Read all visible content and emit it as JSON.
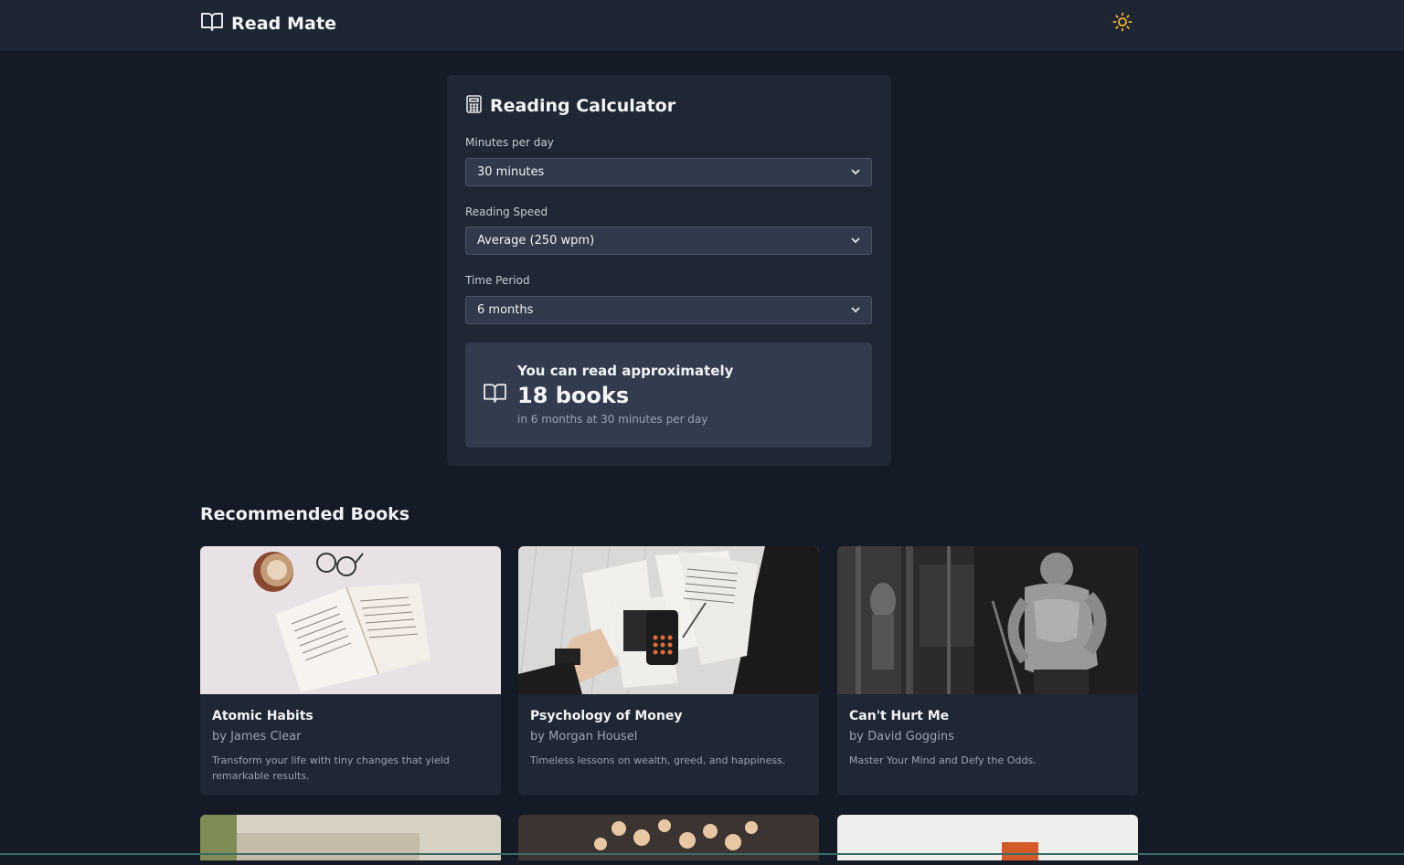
{
  "app": {
    "name": "Read Mate",
    "theme_toggle_icon": "sun-icon",
    "accent_color": "#f5b82e"
  },
  "calculator": {
    "title": "Reading Calculator",
    "icon": "calculator-icon",
    "fields": [
      {
        "label": "Minutes per day",
        "value": "30 minutes"
      },
      {
        "label": "Reading Speed",
        "value": "Average (250 wpm)"
      },
      {
        "label": "Time Period",
        "value": "6 months"
      }
    ],
    "result": {
      "icon": "book-open-icon",
      "lead": "You can read approximately",
      "value": "18 books",
      "detail": "in 6 months at 30 minutes per day"
    }
  },
  "recommended": {
    "title": "Recommended Books",
    "books": [
      {
        "title": "Atomic Habits",
        "author": "by James Clear",
        "description": "Transform your life with tiny changes that yield remarkable results."
      },
      {
        "title": "Psychology of Money",
        "author": "by Morgan Housel",
        "description": "Timeless lessons on wealth, greed, and happiness."
      },
      {
        "title": "Can't Hurt Me",
        "author": "by David Goggins",
        "description": "Master Your Mind and Defy the Odds."
      }
    ]
  }
}
